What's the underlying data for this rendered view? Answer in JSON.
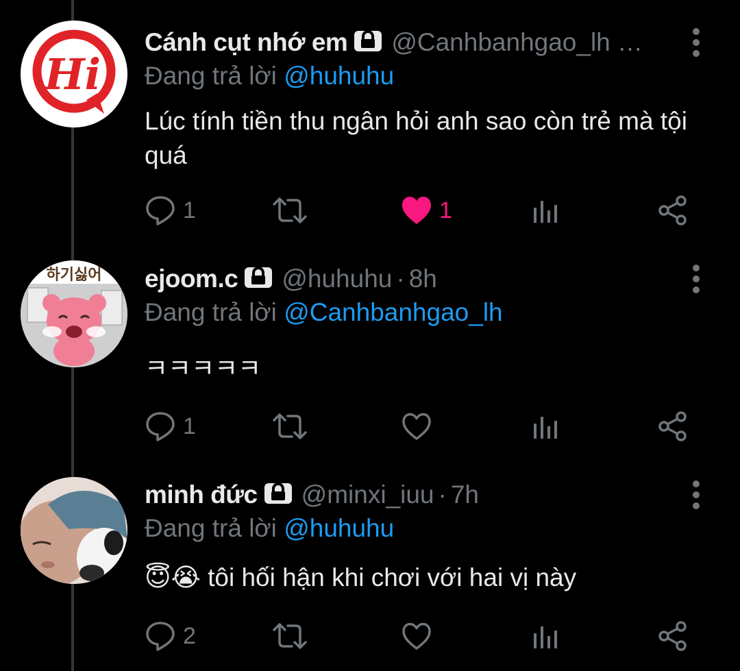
{
  "colors": {
    "background": "#000000",
    "text_primary": "#e7e9ea",
    "text_secondary": "#71767b",
    "mention": "#1d9bf0",
    "like": "#f91880",
    "thread_line": "#333639"
  },
  "tweets": [
    {
      "display_name": "Cánh cụt nhớ em",
      "handle": "@Canhbanhgao_lh …",
      "separator": "",
      "time": "",
      "protected_icon": "lock-icon",
      "reply_prefix": "Đang trả lời ",
      "reply_mention": "@huhuhu",
      "text": "Lúc tính tiền thu ngân hỏi anh sao còn trẻ mà tội quá",
      "avatar": {
        "icon": "hi-speech-bubble-logo",
        "logo_text": "Hi",
        "color": "#e02328"
      },
      "actions": {
        "replies": "1",
        "retweets": "",
        "likes": "1",
        "liked": true
      }
    },
    {
      "display_name": "ejoom.c",
      "handle": "@huhuhu",
      "separator": "·",
      "time": "8h",
      "protected_icon": "lock-icon",
      "reply_prefix": "Đang trả lời ",
      "reply_mention": "@Canhbanhgao_lh",
      "text": "ㅋㅋㅋㅋㅋ",
      "avatar": {
        "icon": "crying-pink-bear-sticker",
        "sticker_text": "하기싫어",
        "color": "#f07f95"
      },
      "actions": {
        "replies": "1",
        "retweets": "",
        "likes": "",
        "liked": false
      }
    },
    {
      "display_name": "minh đức",
      "handle": "@minxi_iuu",
      "separator": "·",
      "time": "7h",
      "protected_icon": "lock-icon",
      "reply_prefix": "Đang trả lời ",
      "reply_mention": "@huhuhu",
      "text": "😇😭 tôi hối hận khi chơi với hai vị này",
      "avatar": {
        "icon": "person-with-cat-photo",
        "color": "#c9a896"
      },
      "actions": {
        "replies": "2",
        "retweets": "",
        "likes": "",
        "liked": false
      }
    }
  ]
}
